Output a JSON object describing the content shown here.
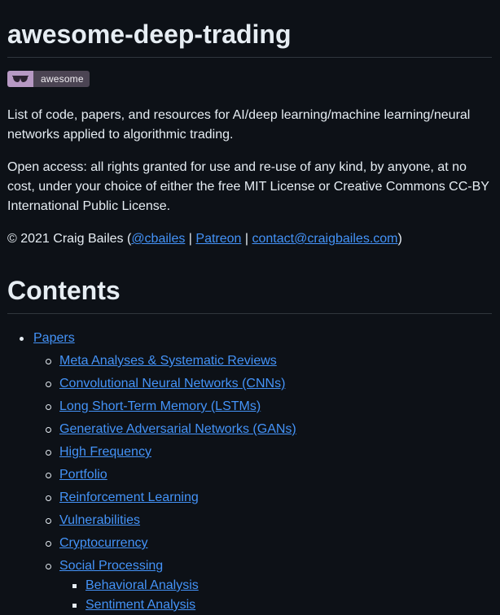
{
  "title": "awesome-deep-trading",
  "badge": {
    "icon": "sunglasses-icon",
    "label": "awesome"
  },
  "intro": "List of code, papers, and resources for AI/deep learning/machine learning/neural networks applied to algorithmic trading.",
  "license": "Open access: all rights granted for use and re-use of any kind, by anyone, at no cost, under your choice of either the free MIT License or Creative Commons CC-BY International Public License.",
  "credit": {
    "prefix": "© 2021 Craig Bailes (",
    "handle": "@cbailes",
    "sep1": " | ",
    "patreon": "Patreon",
    "sep2": " | ",
    "email": "contact@craigbailes.com",
    "suffix": ")"
  },
  "contents_heading": "Contents",
  "toc": {
    "papers": "Papers",
    "items": [
      "Meta Analyses & Systematic Reviews",
      "Convolutional Neural Networks (CNNs)",
      "Long Short-Term Memory (LSTMs)",
      "Generative Adversarial Networks (GANs)",
      "High Frequency",
      "Portfolio",
      "Reinforcement Learning",
      "Vulnerabilities",
      "Cryptocurrency",
      "Social Processing"
    ],
    "social_sub": [
      "Behavioral Analysis",
      "Sentiment Analysis"
    ]
  },
  "colors": {
    "background": "#0d1117",
    "text": "#e6edf3",
    "link": "#4493f8",
    "badge_left": "#b799c4",
    "badge_right": "#4b4453"
  }
}
